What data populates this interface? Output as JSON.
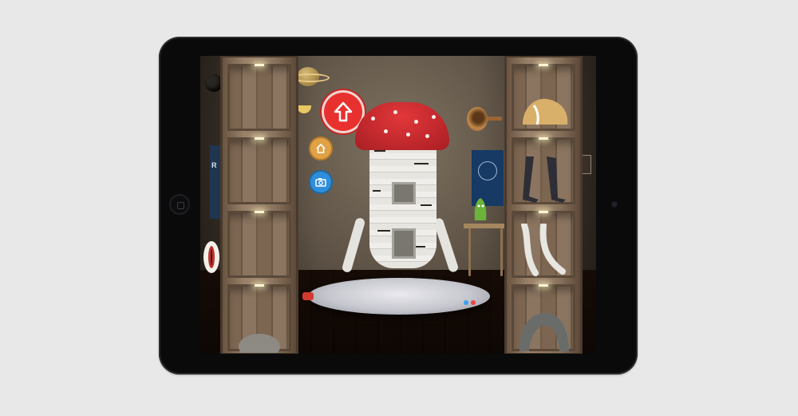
{
  "screen": {
    "poster_left_text": "R",
    "buttons": {
      "up_icon": "arrow-up-icon",
      "home_icon": "home-icon",
      "camera_icon": "camera-icon"
    }
  },
  "colors": {
    "up_button": "#e8312e",
    "home_button": "#e0a247",
    "camera_button": "#2f8edb",
    "mushroom_cap": "#c52a2e",
    "platform_light_blue": "#3aa0f0",
    "platform_light_red": "#e44"
  },
  "left_shelf": {
    "cells": [
      "body-part-slot-1",
      "body-part-slot-2",
      "body-part-slot-3",
      "body-part-slot-4"
    ]
  },
  "right_shelf": {
    "cells": [
      "hat-slot",
      "legs-dark-slot",
      "legs-birch-slot",
      "legs-stone-slot"
    ]
  }
}
